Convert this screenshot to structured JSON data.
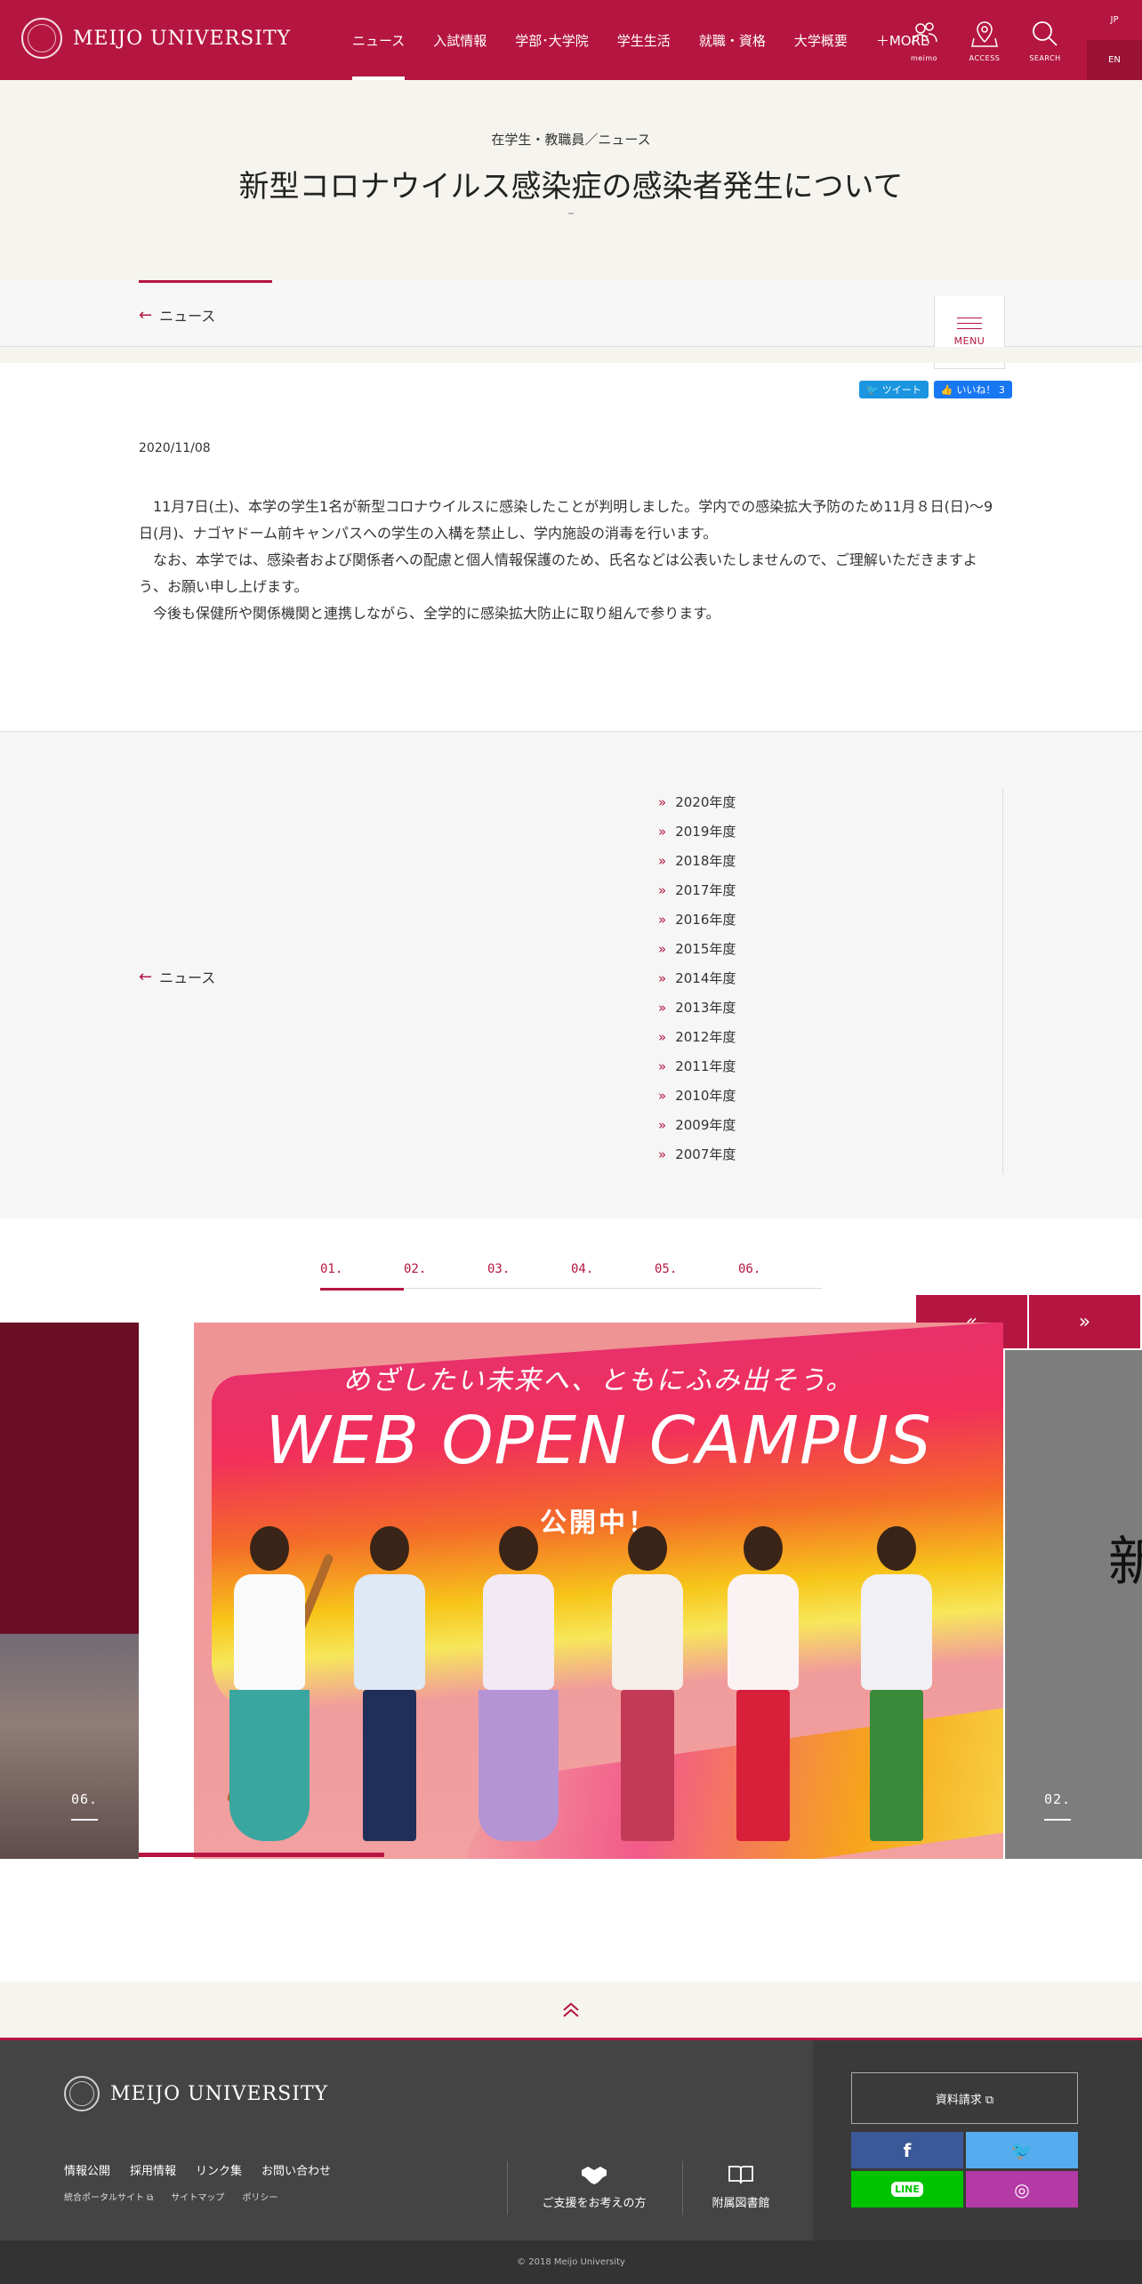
{
  "header": {
    "logo_text": "MEIJO UNIVERSITY",
    "nav": [
      {
        "label": "ニュース"
      },
      {
        "label": "入試情報"
      },
      {
        "label": "学部･大学院"
      },
      {
        "label": "学生生活"
      },
      {
        "label": "就職・資格"
      },
      {
        "label": "大学概要"
      },
      {
        "label": "＋MORE"
      }
    ],
    "icons": [
      {
        "label": "meimo",
        "icon": "people-icon"
      },
      {
        "label": "ACCESS",
        "icon": "map-pin-icon"
      },
      {
        "label": "SEARCH",
        "icon": "search-icon"
      }
    ],
    "lang_jp": "JP",
    "lang_en": "EN",
    "accent_color": "#b51641"
  },
  "title_area": {
    "breadcrumb": "在学生・教職員／ニュース",
    "title": "新型コロナウイルス感染症の感染者発生について",
    "dash": "–"
  },
  "subnav": {
    "back_label": "ニュース",
    "menu_label": "MENU"
  },
  "social": {
    "tweet": "ツイート",
    "like": "いいね！ 3"
  },
  "article": {
    "date": "2020/11/08",
    "paragraphs": [
      "11月7日(土)、本学の学生1名が新型コロナウイルスに感染したことが判明しました。学内での感染拡大予防のため11月８日(日)～9日(月)、ナゴヤドーム前キャンパスへの学生の入構を禁止し、学内施設の消毒を行います。",
      "なお、本学では、感染者および関係者への配慮と個人情報保護のため、氏名などは公表いたしませんので、ご理解いただきますよう、お願い申し上げます。",
      "今後も保健所や関係機関と連携しながら、全学的に感染拡大防止に取り組んで参ります。"
    ]
  },
  "archive": {
    "back_label": "ニュース",
    "years": [
      "2020年度",
      "2019年度",
      "2018年度",
      "2017年度",
      "2016年度",
      "2015年度",
      "2014年度",
      "2013年度",
      "2012年度",
      "2011年度",
      "2010年度",
      "2009年度",
      "2007年度"
    ]
  },
  "carousel": {
    "tabs": [
      "01.",
      "02.",
      "03.",
      "04.",
      "05.",
      "06."
    ],
    "prev": "«",
    "next": "»",
    "left_num": "06.",
    "right_num": "02.",
    "right_text": "新",
    "slide": {
      "catch": "めざしたい未来へ、ともにふみ出そう。",
      "headline": "WEB OPEN CAMPUS",
      "sub": "公開中！"
    }
  },
  "pagetop_icon": "double-chevron-up-icon",
  "footer": {
    "logo_text": "MEIJO UNIVERSITY",
    "links_primary": [
      "情報公開",
      "採用情報",
      "リンク集",
      "お問い合わせ"
    ],
    "links_secondary": [
      "統合ポータルサイト ⧉",
      "サイトマップ",
      "ポリシー"
    ],
    "support_label": "ご支援をお考えの方",
    "library_label": "附属図書館",
    "doc_request": "資料請求 ⧉",
    "sns": [
      {
        "label": "f",
        "color": "#3b5998",
        "icon": "facebook-icon"
      },
      {
        "label": "🐦",
        "color": "#55acee",
        "icon": "twitter-icon"
      },
      {
        "label": "LINE",
        "color": "#00c300",
        "icon": "line-icon"
      },
      {
        "label": "◎",
        "color": "#b43aa6",
        "icon": "instagram-icon"
      }
    ],
    "copyright": "© 2018 Meijo University"
  }
}
